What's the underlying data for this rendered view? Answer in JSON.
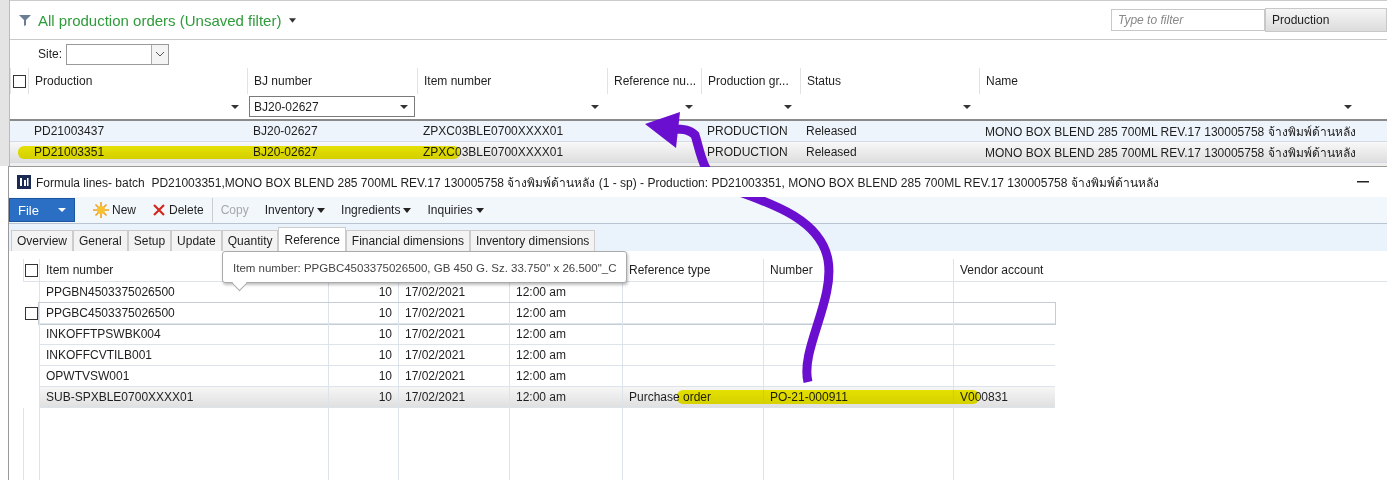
{
  "header": {
    "title": "All production orders (Unsaved filter)",
    "filter": {
      "placeholder": "Type to filter"
    },
    "filter_field": "Production"
  },
  "site": {
    "label": "Site:"
  },
  "orders": {
    "select_all": {
      "checked": false
    },
    "columns": [
      {
        "label": "Production"
      },
      {
        "label": "BJ number",
        "filter": "BJ20-02627"
      },
      {
        "label": "Item number"
      },
      {
        "label": "Reference nu..."
      },
      {
        "label": "Production gr..."
      },
      {
        "label": "Status"
      },
      {
        "label": "Name"
      }
    ],
    "rows": [
      {
        "cells": [
          "PD21003437",
          "BJ20-02627",
          "ZPXC03BLE0700XXXX01",
          "",
          "PRODUCTION",
          "Released",
          "MONO BOX BLEND 285 700ML REV.17 130005758 จ้างพิมพ์ด้านหลัง"
        ],
        "selected": false,
        "highlighted": false
      },
      {
        "cells": [
          "PD21003351",
          "BJ20-02627",
          "ZPXC03BLE0700XXXX01",
          "",
          "PRODUCTION",
          "Released",
          "MONO BOX BLEND 285 700ML REV.17 130005758 จ้างพิมพ์ด้านหลัง"
        ],
        "selected": true,
        "highlighted": true
      }
    ]
  },
  "formula_window": {
    "title": "Formula lines- batch  PD21003351,MONO BOX BLEND 285 700ML REV.17 130005758 จ้างพิมพ์ด้านหลัง (1 - sp) - Production: PD21003351, MONO BOX BLEND 285 700ML REV.17 130005758 จ้างพิมพ์ด้านหลัง",
    "toolbar": [
      {
        "label": "File",
        "kind": "file"
      },
      {
        "label": "New",
        "kind": "new"
      },
      {
        "label": "Delete",
        "kind": "delete"
      },
      {
        "label": "Copy",
        "kind": "plain",
        "disabled": true
      },
      {
        "label": "Inventory",
        "kind": "dropdown"
      },
      {
        "label": "Ingredients",
        "kind": "dropdown"
      },
      {
        "label": "Inquiries",
        "kind": "dropdown"
      }
    ],
    "select_all": {
      "checked": false
    },
    "tabs": [
      {
        "label": "Overview",
        "selected": false
      },
      {
        "label": "General",
        "selected": false
      },
      {
        "label": "Setup",
        "selected": false
      },
      {
        "label": "Update",
        "selected": false
      },
      {
        "label": "Quantity",
        "selected": false
      },
      {
        "label": "Reference",
        "selected": true
      },
      {
        "label": "Financial dimensions",
        "selected": false
      },
      {
        "label": "Inventory dimensions",
        "selected": false
      }
    ],
    "tooltip": "Item number: PPGBC4503375026500, GB 450 G. Sz. 33.750\" x 26.500\"_C",
    "header": {
      "item": "Item number",
      "reference_type": "Reference type",
      "number": "Number",
      "vendor_account": "Vendor account"
    },
    "rows": [
      {
        "item": "PPGBN4503375026500",
        "qty": "10",
        "date": "17/02/2021",
        "time": "12:00 am",
        "selected": false,
        "hovered": false,
        "highlighted": false
      },
      {
        "item": "PPGBC4503375026500",
        "qty": "10",
        "date": "17/02/2021",
        "time": "12:00 am",
        "selected": false,
        "hovered": true,
        "checked": false,
        "highlighted": false
      },
      {
        "item": "INKOFFTPSWBK004",
        "qty": "10",
        "date": "17/02/2021",
        "time": "12:00 am",
        "selected": false,
        "hovered": false,
        "highlighted": false
      },
      {
        "item": "INKOFFCVTILB001",
        "qty": "10",
        "date": "17/02/2021",
        "time": "12:00 am",
        "selected": false,
        "hovered": false,
        "highlighted": false
      },
      {
        "item": "OPWTVSW001",
        "qty": "10",
        "date": "17/02/2021",
        "time": "12:00 am",
        "selected": false,
        "hovered": false,
        "highlighted": false
      },
      {
        "item": "SUB-SPXBLE0700XXXX01",
        "qty": "10",
        "date": "17/02/2021",
        "time": "12:00 am",
        "reference_type": "Purchase order",
        "number": "PO-21-000911",
        "vendor_account": "V000831",
        "selected": true,
        "hovered": false,
        "highlighted": true
      }
    ]
  }
}
